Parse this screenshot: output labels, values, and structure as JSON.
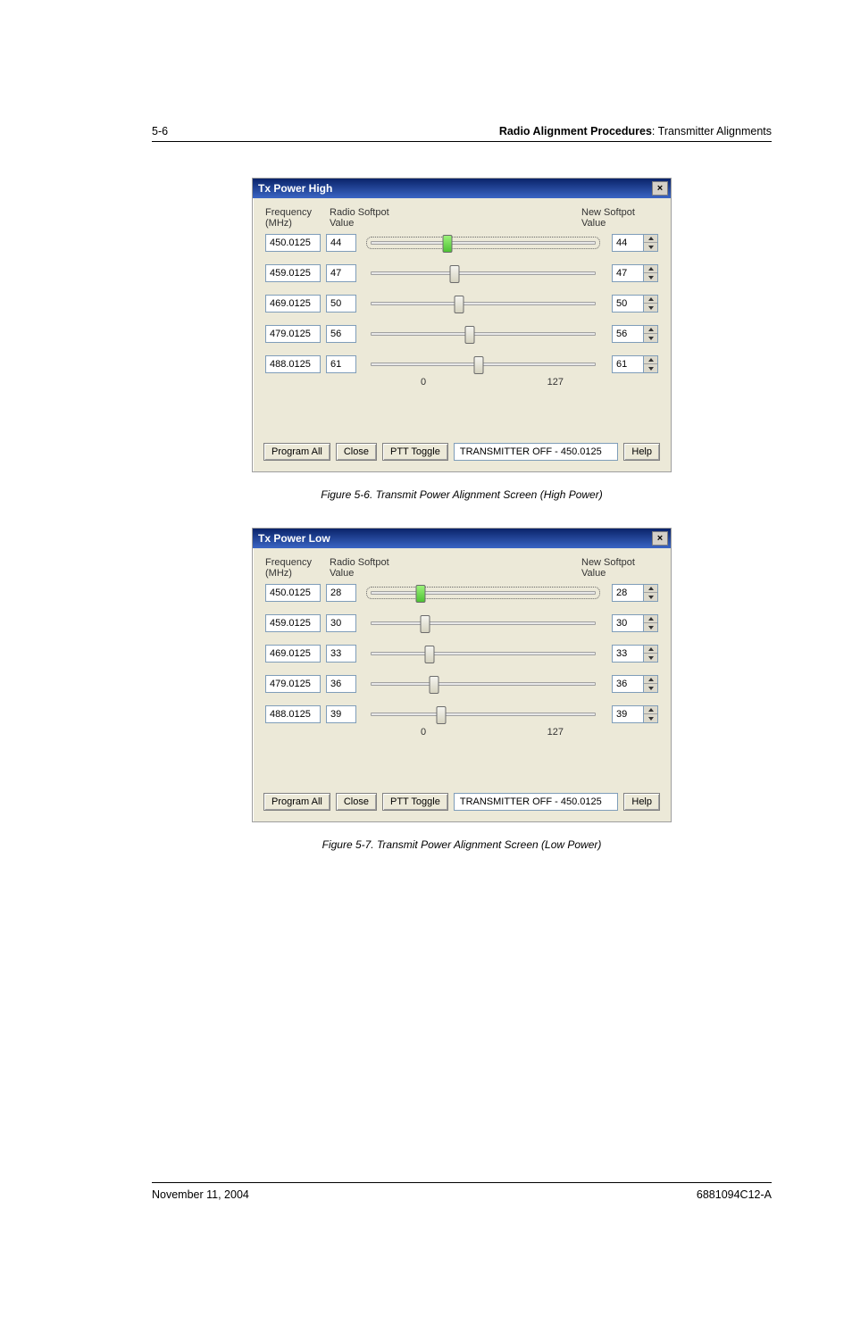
{
  "header": {
    "pageNum": "5-6",
    "sectionBold": "Radio Alignment Procedures",
    "sectionRest": ": Transmitter Alignments"
  },
  "labels": {
    "freq": "Frequency\n(MHz)",
    "radio": "Radio Softpot\nValue",
    "newsp": "New Softpot\nValue",
    "scaleMin": "0",
    "scaleMax": "127"
  },
  "buttons": {
    "programAll": "Program All",
    "close": "Close",
    "pttToggle": "PTT Toggle",
    "help": "Help"
  },
  "closeGlyph": "×",
  "dialogHigh": {
    "title": "Tx Power High",
    "status": "TRANSMITTER OFF - 450.0125",
    "rows": [
      {
        "freq": "450.0125",
        "radio": "44",
        "new": "44",
        "pos": 34,
        "active": true
      },
      {
        "freq": "459.0125",
        "radio": "47",
        "new": "47",
        "pos": 37,
        "active": false
      },
      {
        "freq": "469.0125",
        "radio": "50",
        "new": "50",
        "pos": 39,
        "active": false
      },
      {
        "freq": "479.0125",
        "radio": "56",
        "new": "56",
        "pos": 44,
        "active": false
      },
      {
        "freq": "488.0125",
        "radio": "61",
        "new": "61",
        "pos": 48,
        "active": false
      }
    ]
  },
  "dialogLow": {
    "title": "Tx Power Low",
    "status": "TRANSMITTER OFF - 450.0125",
    "rows": [
      {
        "freq": "450.0125",
        "radio": "28",
        "new": "28",
        "pos": 22,
        "active": true
      },
      {
        "freq": "459.0125",
        "radio": "30",
        "new": "30",
        "pos": 24,
        "active": false
      },
      {
        "freq": "469.0125",
        "radio": "33",
        "new": "33",
        "pos": 26,
        "active": false
      },
      {
        "freq": "479.0125",
        "radio": "36",
        "new": "36",
        "pos": 28,
        "active": false
      },
      {
        "freq": "488.0125",
        "radio": "39",
        "new": "39",
        "pos": 31,
        "active": false
      }
    ]
  },
  "captions": {
    "high": "Figure 5-6.  Transmit Power Alignment Screen (High Power)",
    "low": "Figure 5-7.  Transmit Power Alignment Screen (Low Power)"
  },
  "footer": {
    "date": "November 11, 2004",
    "doc": "6881094C12-A"
  }
}
